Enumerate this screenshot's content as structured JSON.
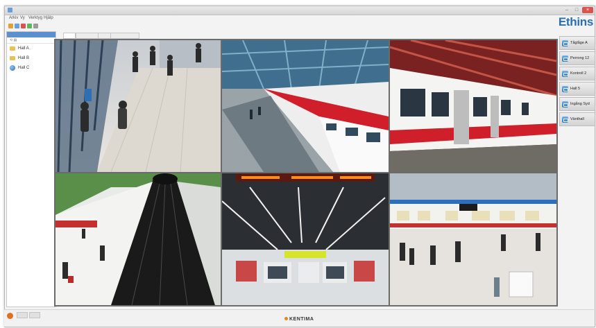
{
  "window": {
    "title": "",
    "brand_logo": "Ethins",
    "footer_brand": "KENTIMA"
  },
  "menu": [
    "Arkiv",
    "Vy",
    "Verktyg",
    "Hjälp"
  ],
  "tree": {
    "items": [
      {
        "label": "Hall A",
        "icon": "folder-icon"
      },
      {
        "label": "Hall B",
        "icon": "folder-icon"
      },
      {
        "label": "Hall C",
        "icon": "globe-icon"
      }
    ]
  },
  "presets": [
    {
      "label": "Tåglåge A"
    },
    {
      "label": "Perrong 12"
    },
    {
      "label": "Kontroll 2"
    },
    {
      "label": "Hall 5"
    },
    {
      "label": "Ingång Syd"
    },
    {
      "label": "Vänthall"
    }
  ],
  "cameras": [
    {
      "name": "camera-concourse"
    },
    {
      "name": "camera-train-platform-left"
    },
    {
      "name": "camera-red-train"
    },
    {
      "name": "camera-escalators"
    },
    {
      "name": "camera-hall-ceiling"
    },
    {
      "name": "camera-platform-people"
    }
  ],
  "colors": {
    "accent": "#2a6fb3",
    "train_red": "#c8202a",
    "record": "#e07020"
  }
}
